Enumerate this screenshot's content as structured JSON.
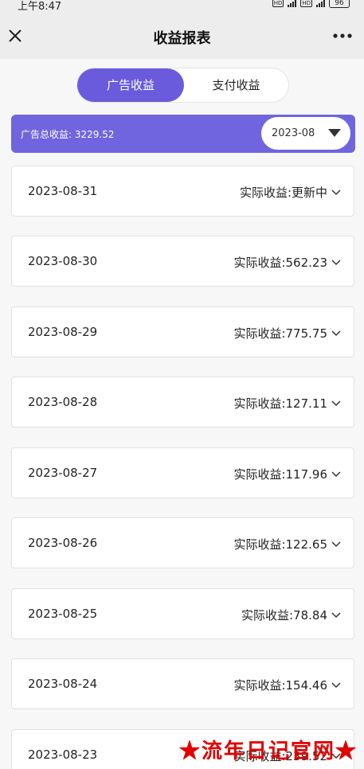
{
  "status_bar": {
    "time": "上午8:47",
    "hd1": "HD",
    "hd2": "HD",
    "battery": "96"
  },
  "header": {
    "title": "收益报表",
    "close_icon": "close-icon",
    "more_icon": "more-icon"
  },
  "tabs": [
    {
      "label": "广告收益",
      "active": true
    },
    {
      "label": "支付收益",
      "active": false
    }
  ],
  "summary": {
    "text": "广告总收益: 3229.52",
    "month": "2023-08"
  },
  "rows": [
    {
      "date": "2023-08-31",
      "income": "实际收益:更新中"
    },
    {
      "date": "2023-08-30",
      "income": "实际收益:562.23"
    },
    {
      "date": "2023-08-29",
      "income": "实际收益:775.75"
    },
    {
      "date": "2023-08-28",
      "income": "实际收益:127.11"
    },
    {
      "date": "2023-08-27",
      "income": "实际收益:117.96"
    },
    {
      "date": "2023-08-26",
      "income": "实际收益:122.65"
    },
    {
      "date": "2023-08-25",
      "income": "实际收益:78.84"
    },
    {
      "date": "2023-08-24",
      "income": "实际收益:154.46"
    },
    {
      "date": "2023-08-23",
      "income": "实际收益:239.52"
    }
  ],
  "watermark": "★流年日记官网★",
  "colors": {
    "accent": "#6a5bdc",
    "summary_bg": "#7065de",
    "watermark": "#e00000"
  }
}
